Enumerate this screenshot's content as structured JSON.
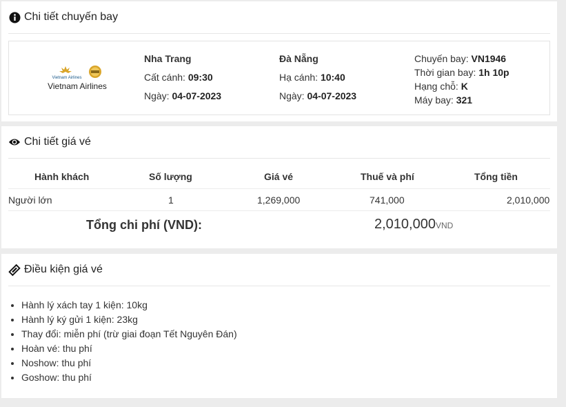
{
  "flight_panel": {
    "title": "Chi tiết chuyến bay",
    "airline": {
      "logo_text": "Vietnam Airlines",
      "name": "Vietnam Airlines"
    },
    "departure": {
      "city": "Nha Trang",
      "time_label": "Cất cánh:",
      "time": "09:30",
      "date_label": "Ngày:",
      "date": "04-07-2023"
    },
    "arrival": {
      "city": "Đà Nẵng",
      "time_label": "Hạ cánh:",
      "time": "10:40",
      "date_label": "Ngày:",
      "date": "04-07-2023"
    },
    "info": {
      "flight_label": "Chuyến bay:",
      "flight": "VN1946",
      "duration_label": "Thời gian bay:",
      "duration": "1h 10p",
      "class_label": "Hạng chỗ:",
      "class": "K",
      "aircraft_label": "Máy bay:",
      "aircraft": "321"
    }
  },
  "price_panel": {
    "title": "Chi tiết giá vé",
    "headers": [
      "Hành khách",
      "Số lượng",
      "Giá vé",
      "Thuế và phí",
      "Tổng tiền"
    ],
    "rows": [
      {
        "passenger": "Người lớn",
        "quantity": "1",
        "fare": "1,269,000",
        "tax": "741,000",
        "total": "2,010,000"
      }
    ],
    "total_label": "Tổng chi phí (VND):",
    "total_value": "2,010,000",
    "currency": "VND"
  },
  "conditions_panel": {
    "title": "Điều kiện giá vé",
    "items": [
      "Hành lý xách tay 1 kiện: 10kg",
      "Hành lý ký gửi 1 kiện: 23kg",
      "Thay đổi: miễn phí (trừ giai đoạn Tết Nguyên Đán)",
      "Hoàn vé: thu phí",
      "Noshow: thu phí",
      "Goshow: thu phí"
    ]
  },
  "colors": {
    "logo_gold": "#d9a52a",
    "logo_blue": "#1b5a8a",
    "text": "#333333"
  },
  "icons": {
    "flight_title": "info-circle-icon",
    "price_title": "eye-icon",
    "conditions_title": "ticket-icon"
  }
}
